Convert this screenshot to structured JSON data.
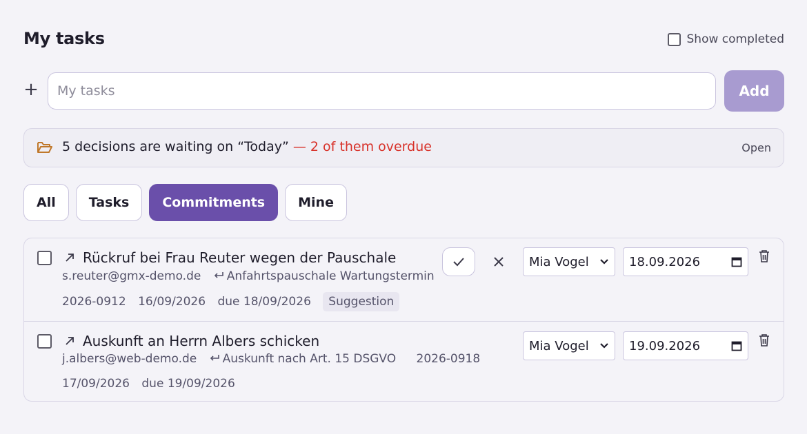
{
  "header": {
    "title": "My tasks",
    "show_completed_label": "Show completed"
  },
  "new_task": {
    "placeholder": "My tasks",
    "add_label": "Add"
  },
  "banner": {
    "text": "5 decisions are waiting on “Today”",
    "overdue": "— 2 of them overdue",
    "open_label": "Open",
    "icon": "folder-open-icon"
  },
  "filters": [
    "All",
    "Tasks",
    "Commitments",
    "Mine"
  ],
  "active_filter": "Commitments",
  "tasks": [
    {
      "title": "Rückruf bei Frau Reuter wegen der Pauschale",
      "email": "s.reuter@gmx-demo.de",
      "thread": "Anfahrtspauschale Wartungstermin",
      "ref": "2026-0912",
      "created": "16/09/2026",
      "due": "due 18/09/2026",
      "badge": "Suggestion",
      "assignee": "Mia Vogel",
      "date": "18.09.2026"
    },
    {
      "title": "Auskunft an Herrn Albers schicken",
      "email": "j.albers@web-demo.de",
      "thread": "Auskunft nach Art. 15 DSGVO",
      "ref": "2026-0918",
      "created": "17/09/2026",
      "due": "due 19/09/2026",
      "assignee": "Mia Vogel",
      "date": "19.09.2026"
    }
  ],
  "colors": {
    "accent": "#6a4faa",
    "add_button": "#a89bd0",
    "overdue": "#d8322a",
    "folder_icon": "#c0782a"
  }
}
